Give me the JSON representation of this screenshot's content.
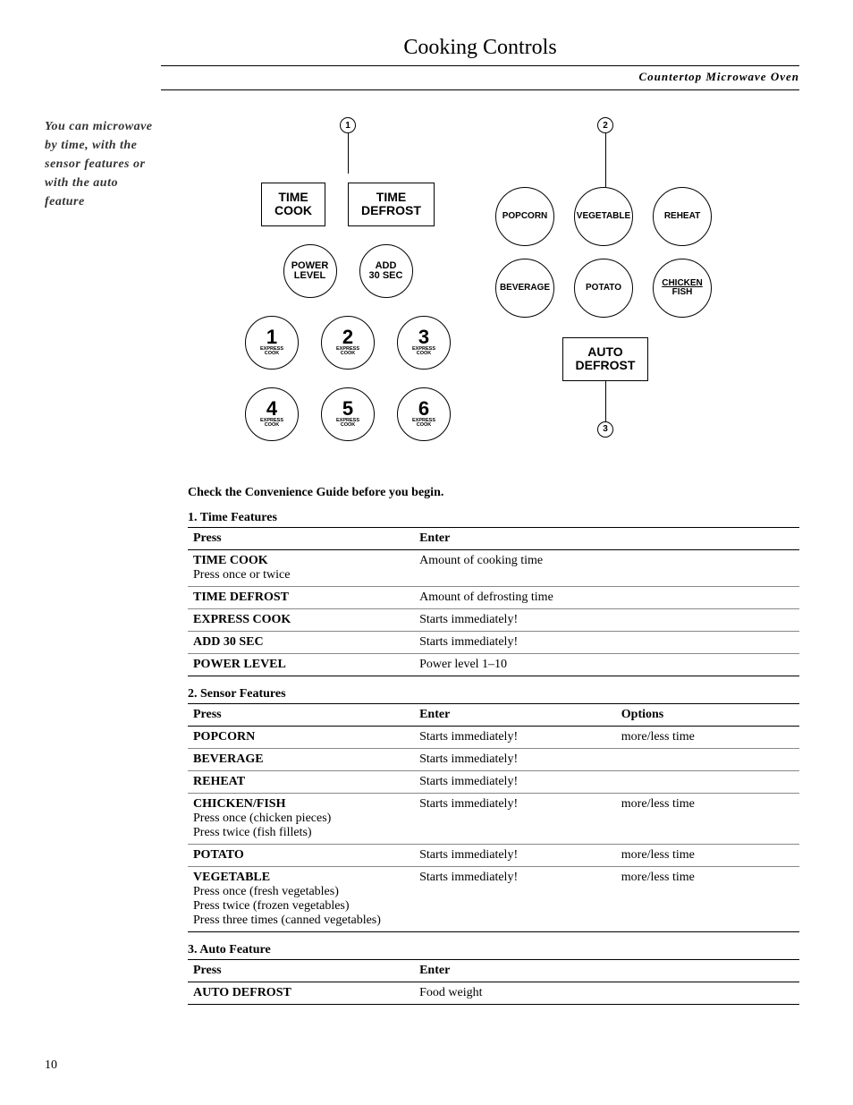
{
  "page_title": "Cooking Controls",
  "subtitle": "Countertop Microwave Oven",
  "side_note": "You can microwave by time, with the sensor features or with the auto feature",
  "diagram": {
    "callouts": {
      "one": "1",
      "two": "2",
      "three": "3"
    },
    "left": {
      "time_cook": "TIME\nCOOK",
      "time_defrost": "TIME\nDEFROST",
      "power_level": "POWER\nLEVEL",
      "add_30": "ADD\n30 SEC",
      "express_label": "EXPRESS\nCOOK",
      "nums": [
        "1",
        "2",
        "3",
        "4",
        "5",
        "6"
      ]
    },
    "right": {
      "popcorn": "POPCORN",
      "vegetable": "VEGETABLE",
      "reheat": "REHEAT",
      "beverage": "BEVERAGE",
      "potato": "POTATO",
      "chicken_fish_l1": "CHICKEN",
      "chicken_fish_l2": "FISH",
      "auto_defrost": "AUTO\nDEFROST"
    }
  },
  "lead": "Check the Convenience Guide before you begin.",
  "sections": {
    "time": {
      "title": "1. Time Features",
      "cols": {
        "press": "Press",
        "enter": "Enter"
      },
      "rows": [
        {
          "press": "TIME COOK",
          "sub": "Press once or twice",
          "enter": "Amount of cooking time"
        },
        {
          "press": "TIME DEFROST",
          "enter": "Amount of defrosting time"
        },
        {
          "press": "EXPRESS COOK",
          "enter": "Starts immediately!"
        },
        {
          "press": "ADD 30 SEC",
          "enter": "Starts immediately!"
        },
        {
          "press": "POWER LEVEL",
          "enter": "Power level 1–10"
        }
      ]
    },
    "sensor": {
      "title": "2. Sensor Features",
      "cols": {
        "press": "Press",
        "enter": "Enter",
        "options": "Options"
      },
      "rows": [
        {
          "press": "POPCORN",
          "enter": "Starts immediately!",
          "options": "more/less time"
        },
        {
          "press": "BEVERAGE",
          "enter": "Starts immediately!",
          "options": ""
        },
        {
          "press": "REHEAT",
          "enter": "Starts immediately!",
          "options": ""
        },
        {
          "press": "CHICKEN/FISH",
          "sub1": "Press once (chicken pieces)",
          "sub2": "Press twice (fish fillets)",
          "enter": "Starts immediately!",
          "options": "more/less time"
        },
        {
          "press": "POTATO",
          "enter": "Starts immediately!",
          "options": "more/less time"
        },
        {
          "press": "VEGETABLE",
          "sub1": "Press once (fresh vegetables)",
          "sub2": "Press twice (frozen vegetables)",
          "sub3": "Press three times (canned vegetables)",
          "enter": "Starts immediately!",
          "options": "more/less time"
        }
      ]
    },
    "auto": {
      "title": "3. Auto Feature",
      "cols": {
        "press": "Press",
        "enter": "Enter"
      },
      "rows": [
        {
          "press": "AUTO DEFROST",
          "enter": "Food weight"
        }
      ]
    }
  },
  "page_number": "10"
}
